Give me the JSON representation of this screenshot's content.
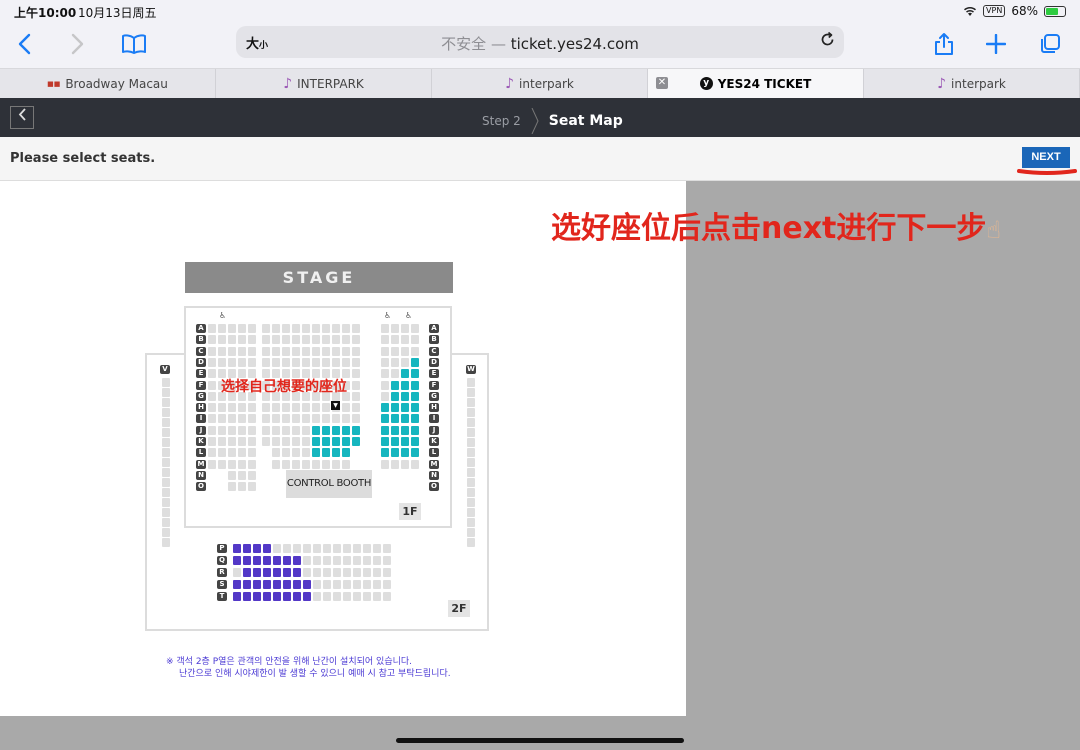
{
  "status": {
    "time": "上午10:00",
    "date": "10月13日周五",
    "vpn": "VPN",
    "battery": "68%",
    "battery_level": 0.68
  },
  "toolbar": {
    "text_size": "大",
    "text_size_small": "小",
    "insecure": "不安全",
    "separator": "—",
    "url": "ticket.yes24.com"
  },
  "tabs": [
    {
      "label": "Broadway Macau",
      "favicon": "broadway-favicon"
    },
    {
      "label": "INTERPARK",
      "favicon": "interpark-favicon"
    },
    {
      "label": "interpark",
      "favicon": "interpark-favicon"
    },
    {
      "label": "YES24 TICKET",
      "favicon": "yes24-favicon",
      "active": true
    },
    {
      "label": "interpark",
      "favicon": "interpark-favicon"
    }
  ],
  "header": {
    "step_label": "Step 2",
    "step_title": "Seat Map"
  },
  "subbar": {
    "message": "Please select seats.",
    "next_label": "NEXT"
  },
  "annotation": {
    "text": "选好座位后点击next进行下一步",
    "map_note": "选择自己想要的座位"
  },
  "seatmap": {
    "stage": "STAGE",
    "booth": "CONTROL BOOTH",
    "floor1": "1F",
    "floor2": "2F",
    "left_balcony": "V",
    "right_balcony": "W",
    "rows_1f": [
      "A",
      "B",
      "C",
      "D",
      "E",
      "F",
      "G",
      "H",
      "I",
      "J",
      "K",
      "L",
      "M",
      "N",
      "O"
    ],
    "rows_2f": [
      "P",
      "Q",
      "R",
      "S",
      "T"
    ],
    "colors": {
      "available_1f": "#16b6bf",
      "available_2f": "#5338c7",
      "unavailable": "#dedede"
    },
    "footnote_1": "※ 객석 2층 P열은 관객의 안전을 위해 난간이 설치되어 있습니다.",
    "footnote_2": "난간으로 인해 시야제한이 발 생할 수 있으니 예매 시 참고 부탁드립니다."
  }
}
